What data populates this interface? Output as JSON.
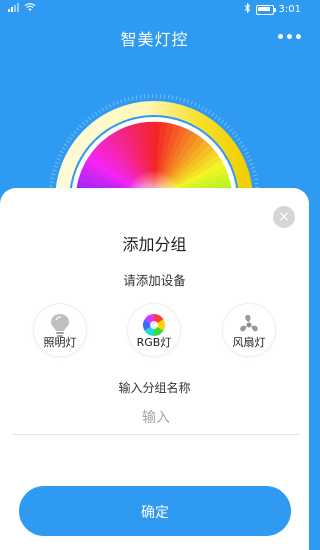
{
  "status_bar": {
    "signal_text": "×",
    "time": "3:01"
  },
  "header": {
    "title": "智美灯控",
    "more_icon": "more-dots-icon"
  },
  "dialog": {
    "title": "添加分组",
    "subtitle": "请添加设备",
    "devices": [
      {
        "label": "照明灯",
        "icon": "bulb-icon"
      },
      {
        "label": "RGB灯",
        "icon": "rgb-wheel-icon"
      },
      {
        "label": "风扇灯",
        "icon": "fan-icon"
      }
    ],
    "group_name_label": "输入分组名称",
    "group_name_placeholder": "输入",
    "confirm_label": "确定",
    "close_icon": "close-icon"
  },
  "colors": {
    "primary": "#2f9af1",
    "ring_yellow": "#f5d300",
    "ring_white": "#fffbd0",
    "close_bg": "#d6d6d6"
  }
}
